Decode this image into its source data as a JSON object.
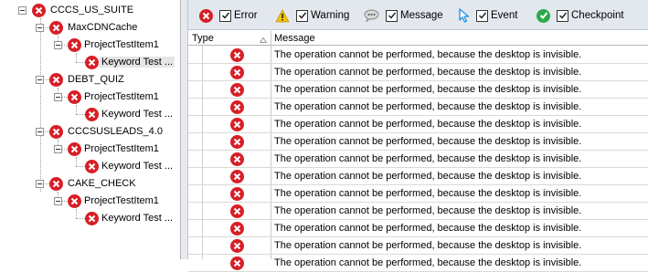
{
  "tree": {
    "nodes": [
      {
        "label": "CCCS_US_SUITE"
      },
      {
        "label": "MaxCDNCache"
      },
      {
        "label": "ProjectTestItem1"
      },
      {
        "label": "Keyword Test ..."
      },
      {
        "label": "DEBT_QUIZ"
      },
      {
        "label": "ProjectTestItem1"
      },
      {
        "label": "Keyword Test ..."
      },
      {
        "label": "CCCSUSLEADS_4.0"
      },
      {
        "label": "ProjectTestItem1"
      },
      {
        "label": "Keyword Test ..."
      },
      {
        "label": "CAKE_CHECK"
      },
      {
        "label": "ProjectTestItem1"
      },
      {
        "label": "Keyword Test ..."
      }
    ]
  },
  "toolbar": {
    "error_label": "Error",
    "warning_label": "Warning",
    "message_label": "Message",
    "event_label": "Event",
    "checkpoint_label": "Checkpoint"
  },
  "grid": {
    "col_type": "Type",
    "col_message": "Message",
    "rows": [
      {
        "message": "The operation cannot be performed, because the desktop is invisible."
      },
      {
        "message": "The operation cannot be performed, because the desktop is invisible."
      },
      {
        "message": "The operation cannot be performed, because the desktop is invisible."
      },
      {
        "message": "The operation cannot be performed, because the desktop is invisible."
      },
      {
        "message": "The operation cannot be performed, because the desktop is invisible."
      },
      {
        "message": "The operation cannot be performed, because the desktop is invisible."
      },
      {
        "message": "The operation cannot be performed, because the desktop is invisible."
      },
      {
        "message": "The operation cannot be performed, because the desktop is invisible."
      },
      {
        "message": "The operation cannot be performed, because the desktop is invisible."
      },
      {
        "message": "The operation cannot be performed, because the desktop is invisible."
      },
      {
        "message": "The operation cannot be performed, because the desktop is invisible."
      },
      {
        "message": "The operation cannot be performed, because the desktop is invisible."
      },
      {
        "message": "The operation cannot be performed, because the desktop is invisible."
      }
    ]
  },
  "colors": {
    "error": "#d81e26",
    "warning": "#f5c400",
    "event": "#1e90e0",
    "checkpoint": "#2ea84a",
    "toolbar_bg": "#e3e8ef"
  }
}
